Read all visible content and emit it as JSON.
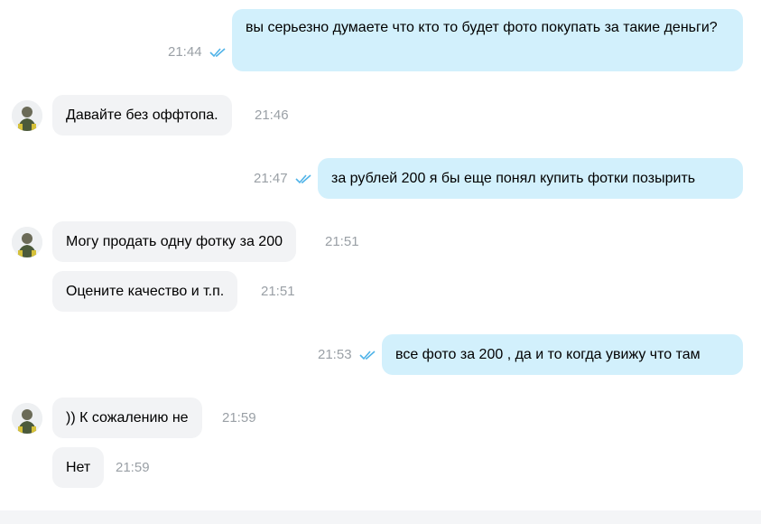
{
  "messages": [
    {
      "side": "out",
      "text": "вы серьезно думаете что кто то будет фото покупать за такие деньги?",
      "time": "21:44",
      "status": "read"
    },
    {
      "side": "in",
      "text": "Давайте без оффтопа.",
      "time": "21:46"
    },
    {
      "side": "out",
      "text": "за рублей 200 я бы еще понял купить фотки позырить",
      "time": "21:47",
      "status": "read"
    },
    {
      "side": "in",
      "text": "Могу продать одну фотку за 200",
      "time": "21:51"
    },
    {
      "side": "in",
      "text": "Оцените качество и т.п.",
      "time": "21:51"
    },
    {
      "side": "out",
      "text": "все фото за 200 , да и то когда увижу что там",
      "time": "21:53",
      "status": "read"
    },
    {
      "side": "in",
      "text": ")) К сожалению не",
      "time": "21:59"
    },
    {
      "side": "in",
      "text": "Нет",
      "time": "21:59"
    }
  ],
  "colors": {
    "outgoing_bubble": "#d2f0fc",
    "incoming_bubble": "#f2f3f5",
    "read_check": "#4fb3e8",
    "timestamp": "#9aa0a6"
  },
  "icons": {
    "read_status": "double-check-icon",
    "avatar": "user-avatar"
  }
}
